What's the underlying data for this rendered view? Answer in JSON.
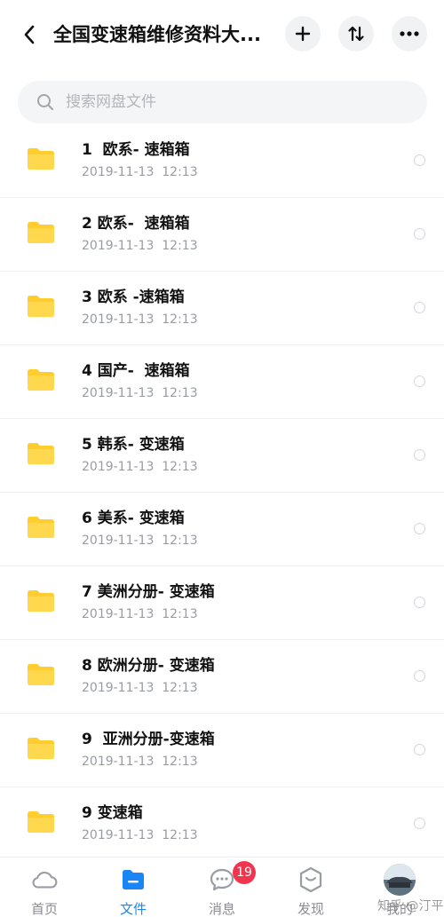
{
  "header": {
    "title": "全国变速箱维修资料大..."
  },
  "search": {
    "placeholder": "搜索网盘文件"
  },
  "files": [
    {
      "name": "1  欧系- 速箱箱",
      "date": "2019-11-13  12:13"
    },
    {
      "name": "2 欧系-  速箱箱",
      "date": "2019-11-13  12:13"
    },
    {
      "name": "3 欧系 -速箱箱",
      "date": "2019-11-13  12:13"
    },
    {
      "name": "4 国产-  速箱箱",
      "date": "2019-11-13  12:13"
    },
    {
      "name": "5 韩系- 变速箱",
      "date": "2019-11-13  12:13"
    },
    {
      "name": "6 美系- 变速箱",
      "date": "2019-11-13  12:13"
    },
    {
      "name": "7 美洲分册- 变速箱",
      "date": "2019-11-13  12:13"
    },
    {
      "name": "8 欧洲分册- 变速箱",
      "date": "2019-11-13  12:13"
    },
    {
      "name": "9  亚洲分册-变速箱",
      "date": "2019-11-13  12:13"
    },
    {
      "name": "9 变速箱",
      "date": "2019-11-13  12:13"
    }
  ],
  "tabs": [
    {
      "label": "首页",
      "icon": "cloud-icon"
    },
    {
      "label": "文件",
      "icon": "folder-icon"
    },
    {
      "label": "消息",
      "icon": "chat-icon"
    },
    {
      "label": "发现",
      "icon": "discover-icon"
    },
    {
      "label": "我的",
      "icon": "avatar"
    }
  ],
  "messages_badge": "19",
  "watermark": "知乎 @汀平",
  "colors": {
    "accent": "#1a86f5",
    "folder": "#ffce2e",
    "badge": "#f0364e"
  }
}
